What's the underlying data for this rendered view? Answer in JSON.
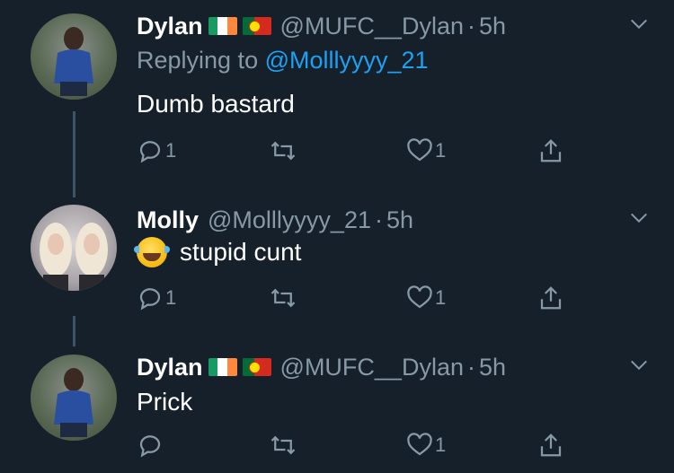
{
  "tweets": [
    {
      "name": "Dylan",
      "flags": [
        "ireland-flag",
        "portugal-flag"
      ],
      "handle": "@MUFC__Dylan",
      "time": "5h",
      "replying_prefix": "Replying to",
      "replying_handle": "@Molllyyyy_21",
      "text": "Dumb bastard",
      "reply_count": "1",
      "retweet_count": "",
      "like_count": "1"
    },
    {
      "name": "Molly",
      "handle": "@Molllyyyy_21",
      "time": "5h",
      "emoji": "face-with-tears-of-joy",
      "text": "stupid cunt",
      "reply_count": "1",
      "retweet_count": "",
      "like_count": "1"
    },
    {
      "name": "Dylan",
      "flags": [
        "ireland-flag",
        "portugal-flag"
      ],
      "handle": "@MUFC__Dylan",
      "time": "5h",
      "text": "Prick",
      "reply_count": "",
      "retweet_count": "",
      "like_count": "1"
    }
  ],
  "separator": "·",
  "colors": {
    "background": "#15202b",
    "secondary_text": "#8899a6",
    "mention": "#1da1f2",
    "thread_line": "#3d5466"
  },
  "icons": [
    "reply-icon",
    "retweet-icon",
    "like-icon",
    "share-icon",
    "chevron-down-icon"
  ]
}
